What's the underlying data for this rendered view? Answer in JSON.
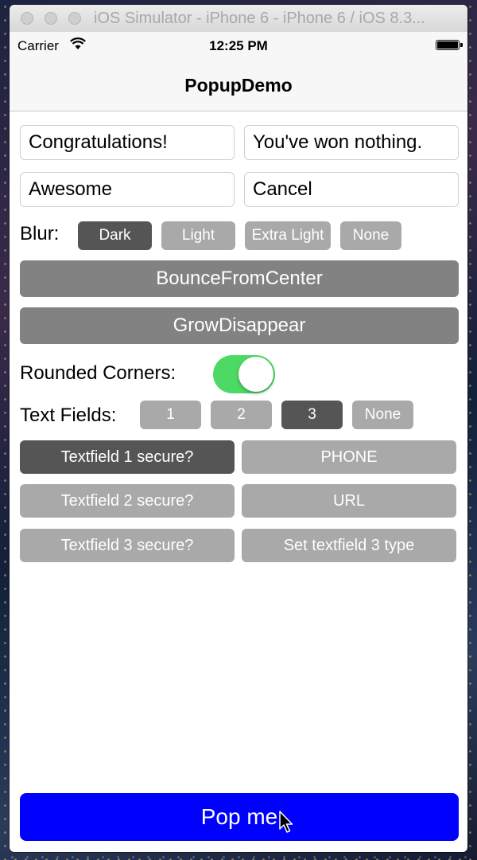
{
  "window": {
    "title": "iOS Simulator - iPhone 6 - iPhone 6 / iOS 8.3..."
  },
  "status_bar": {
    "carrier": "Carrier",
    "time": "12:25 PM"
  },
  "nav": {
    "title": "PopupDemo"
  },
  "fields": {
    "title": "Congratulations!",
    "message": "You've won nothing.",
    "ok": "Awesome",
    "cancel": "Cancel"
  },
  "blur": {
    "label": "Blur:",
    "options": [
      "Dark",
      "Light",
      "Extra Light",
      "None"
    ],
    "selected": "Dark"
  },
  "animations": {
    "show": "BounceFromCenter",
    "hide": "GrowDisappear"
  },
  "rounded_corners": {
    "label": "Rounded Corners:",
    "on": true
  },
  "text_fields": {
    "label": "Text Fields:",
    "options": [
      "1",
      "2",
      "3",
      "None"
    ],
    "selected": "3"
  },
  "secure": {
    "tf1": "Textfield 1 secure?",
    "tf2": "Textfield 2 secure?",
    "tf3": "Textfield 3 secure?",
    "type1": "PHONE",
    "type2": "URL",
    "type3": "Set textfield 3 type"
  },
  "pop_button": "Pop me",
  "colors": {
    "accent": "#0000ff",
    "toggle_on": "#4cd964",
    "selected": "#555555",
    "unselected": "#a9a9a9"
  }
}
